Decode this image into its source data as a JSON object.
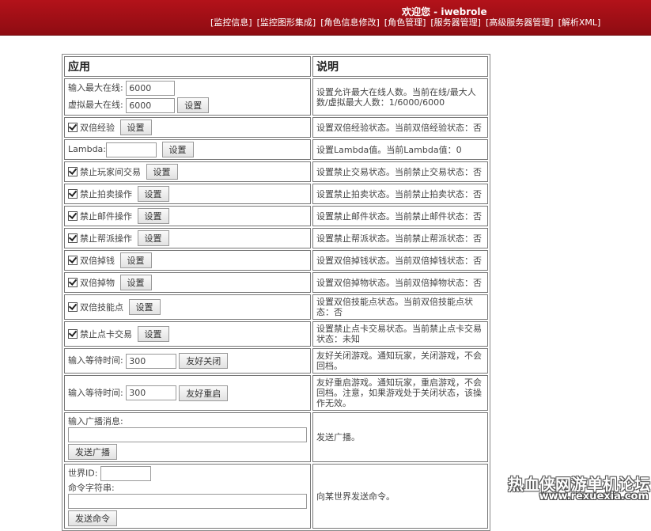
{
  "header": {
    "welcome": "欢迎您 - iwebrole",
    "nav": [
      "[监控信息]",
      "[监控图形集成]",
      "[角色信息修改]",
      "[角色管理]",
      "[服务器管理]",
      "[高级服务器管理]",
      "[解析XML]"
    ]
  },
  "table": {
    "col_app": "应用",
    "col_desc": "说明"
  },
  "rows": {
    "online": {
      "label_max": "输入最大在线:",
      "value_max": "6000",
      "label_virtual": "虚拟最大在线:",
      "value_virtual": "6000",
      "button": "设置",
      "desc": "设置允许最大在线人数。当前在线/最大人数/虚拟最大人数：1/6000/6000"
    },
    "double_exp": {
      "label": "双倍经验",
      "checked": true,
      "button": "设置",
      "desc": "设置双倍经验状态。当前双倍经验状态：否"
    },
    "lambda": {
      "label": "Lambda:",
      "value": "",
      "button": "设置",
      "desc": "设置Lambda值。当前Lambda值：0"
    },
    "no_trade": {
      "label": "禁止玩家间交易",
      "checked": true,
      "button": "设置",
      "desc": "设置禁止交易状态。当前禁止交易状态：否"
    },
    "no_auction": {
      "label": "禁止拍卖操作",
      "checked": true,
      "button": "设置",
      "desc": "设置禁止拍卖状态。当前禁止拍卖状态：否"
    },
    "no_mail": {
      "label": "禁止邮件操作",
      "checked": true,
      "button": "设置",
      "desc": "设置禁止邮件状态。当前禁止邮件状态：否"
    },
    "no_guild": {
      "label": "禁止帮派操作",
      "checked": true,
      "button": "设置",
      "desc": "设置禁止帮派状态。当前禁止帮派状态：否"
    },
    "double_money": {
      "label": "双倍掉钱",
      "checked": true,
      "button": "设置",
      "desc": "设置双倍掉钱状态。当前双倍掉钱状态：否"
    },
    "double_item": {
      "label": "双倍掉物",
      "checked": true,
      "button": "设置",
      "desc": "设置双倍掉物状态。当前双倍掉物状态：否"
    },
    "double_skill": {
      "label": "双倍技能点",
      "checked": true,
      "button": "设置",
      "desc": "设置双倍技能点状态。当前双倍技能点状态：否"
    },
    "no_card_trade": {
      "label": "禁止点卡交易",
      "checked": true,
      "button": "设置",
      "desc": "设置禁止点卡交易状态。当前禁止点卡交易状态：未知"
    },
    "shutdown": {
      "label": "输入等待时间:",
      "value": "300",
      "button": "友好关闭",
      "desc": "友好关闭游戏。通知玩家，关闭游戏，不会回档。"
    },
    "restart": {
      "label": "输入等待时间:",
      "value": "300",
      "button": "友好重启",
      "desc": "友好重启游戏。通知玩家，重启游戏，不会回档。注意，如果游戏处于关闭状态，该操作无效。"
    },
    "broadcast": {
      "label": "输入广播消息:",
      "value": "",
      "button": "发送广播",
      "desc": "发送广播。"
    },
    "command": {
      "label_world": "世界ID:",
      "value_world": "",
      "label_cmd": "命令字符串:",
      "value_cmd": "",
      "button": "发送命令",
      "desc": "向某世界发送命令。"
    }
  },
  "watermark": {
    "line1": "热血侠网游单机论坛",
    "line2": "www.rexuexia.com"
  }
}
